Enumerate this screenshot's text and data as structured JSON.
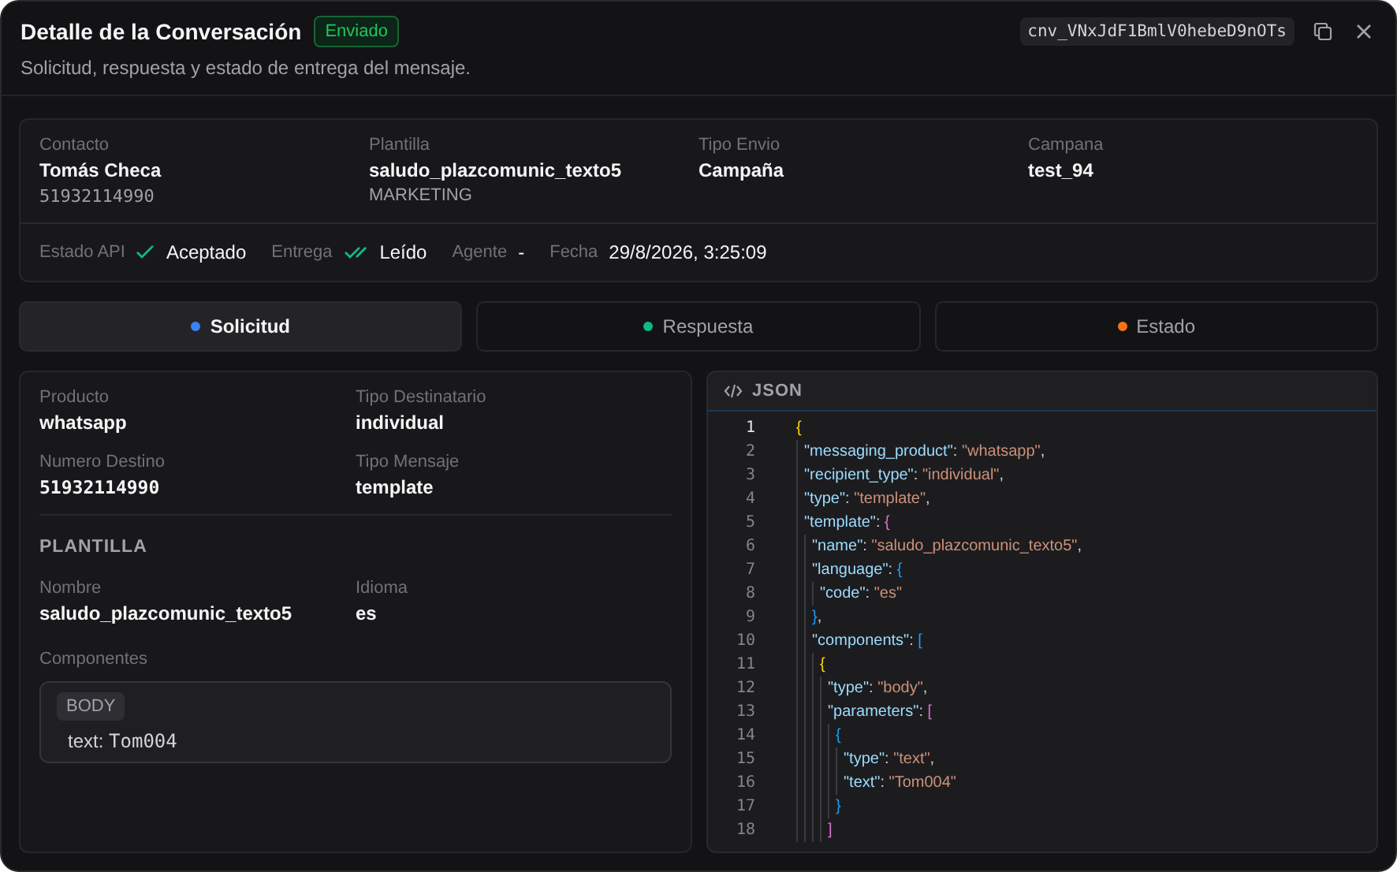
{
  "header": {
    "title": "Detalle de la Conversación",
    "badge": "Enviado",
    "subtitle": "Solicitud, respuesta y estado de entrega del mensaje.",
    "conversation_id": "cnv_VNxJdF1BmlV0hebeD9nOTs"
  },
  "summary": {
    "fields": [
      {
        "label": "Contacto",
        "value": "Tomás Checa",
        "sub": {
          "text": "51932114990",
          "kind": "mono"
        }
      },
      {
        "label": "Plantilla",
        "value": "saludo_plazcomunic_texto5",
        "sub": {
          "text": "MARKETING",
          "kind": "plain"
        }
      },
      {
        "label": "Tipo Envio",
        "value": "Campaña"
      },
      {
        "label": "Campana",
        "value": "test_94"
      }
    ],
    "status": [
      {
        "label": "Estado API",
        "kind": "check",
        "value": "Aceptado"
      },
      {
        "label": "Entrega",
        "kind": "double",
        "value": "Leído"
      },
      {
        "label": "Agente",
        "kind": "plain",
        "value": "-"
      },
      {
        "label": "Fecha",
        "kind": "plain",
        "value": "29/8/2026, 3:25:09"
      }
    ]
  },
  "tabs": [
    {
      "label": "Solicitud",
      "selected": true,
      "color": "#3b82f6"
    },
    {
      "label": "Respuesta",
      "selected": false,
      "color": "#10b981"
    },
    {
      "label": "Estado",
      "selected": false,
      "color": "#f97316"
    }
  ],
  "request": {
    "fields": [
      {
        "label": "Producto",
        "value": "whatsapp",
        "kind": "plain"
      },
      {
        "label": "Tipo Destinatario",
        "value": "individual",
        "kind": "plain"
      },
      {
        "label": "Numero Destino",
        "value": "51932114990",
        "kind": "mono"
      },
      {
        "label": "Tipo Mensaje",
        "value": "template",
        "kind": "plain"
      }
    ],
    "section_title": "PLANTILLA",
    "template_fields": [
      {
        "label": "Nombre",
        "value": "saludo_plazcomunic_texto5",
        "kind": "plain"
      },
      {
        "label": "Idioma",
        "value": "es",
        "kind": "plain"
      }
    ],
    "components_label": "Componentes",
    "components": [
      {
        "type": "BODY",
        "params": [
          {
            "key": "text:",
            "value": "Tom004"
          }
        ]
      }
    ]
  },
  "json_panel": {
    "title": "JSON",
    "lines": [
      {
        "number": "1",
        "tokens": [
          {
            "kind": "brace",
            "text": "{"
          }
        ]
      },
      {
        "number": "2",
        "tokens": [
          {
            "kind": "key",
            "text": " \"messaging_product\""
          },
          {
            "kind": "punct",
            "text": ": "
          },
          {
            "kind": "string",
            "text": "\"whatsapp\""
          },
          {
            "kind": "punct",
            "text": ","
          }
        ]
      },
      {
        "number": "3",
        "tokens": [
          {
            "kind": "key",
            "text": " \"recipient_type\""
          },
          {
            "kind": "punct",
            "text": ": "
          },
          {
            "kind": "string",
            "text": "\"individual\""
          },
          {
            "kind": "punct",
            "text": ","
          }
        ]
      },
      {
        "number": "4",
        "tokens": [
          {
            "kind": "key",
            "text": " \"type\""
          },
          {
            "kind": "punct",
            "text": ": "
          },
          {
            "kind": "string",
            "text": "\"template\""
          },
          {
            "kind": "punct",
            "text": ","
          }
        ]
      },
      {
        "number": "5",
        "tokens": [
          {
            "kind": "key",
            "text": " \"template\""
          },
          {
            "kind": "punct",
            "text": ": "
          },
          {
            "kind": "bracket",
            "text": "{"
          }
        ]
      },
      {
        "number": "6",
        "tokens": [
          {
            "kind": "key",
            "text": "  \"name\""
          },
          {
            "kind": "punct",
            "text": ": "
          },
          {
            "kind": "string",
            "text": "\"saludo_plazcomunic_texto5\""
          },
          {
            "kind": "punct",
            "text": ","
          }
        ]
      },
      {
        "number": "7",
        "tokens": [
          {
            "kind": "key",
            "text": "  \"language\""
          },
          {
            "kind": "punct",
            "text": ": "
          },
          {
            "kind": "paren",
            "text": "{"
          }
        ]
      },
      {
        "number": "8",
        "tokens": [
          {
            "kind": "key",
            "text": "   \"code\""
          },
          {
            "kind": "punct",
            "text": ": "
          },
          {
            "kind": "string",
            "text": "\"es\""
          }
        ]
      },
      {
        "number": "9",
        "tokens": [
          {
            "kind": "paren",
            "text": "  }"
          },
          {
            "kind": "punct",
            "text": ","
          }
        ]
      },
      {
        "number": "10",
        "tokens": [
          {
            "kind": "key",
            "text": "  \"components\""
          },
          {
            "kind": "punct",
            "text": ": "
          },
          {
            "kind": "paren",
            "text": "["
          }
        ]
      },
      {
        "number": "11",
        "tokens": [
          {
            "kind": "brace",
            "text": "   {"
          }
        ]
      },
      {
        "number": "12",
        "tokens": [
          {
            "kind": "key",
            "text": "    \"type\""
          },
          {
            "kind": "punct",
            "text": ": "
          },
          {
            "kind": "string",
            "text": "\"body\""
          },
          {
            "kind": "punct",
            "text": ","
          }
        ]
      },
      {
        "number": "13",
        "tokens": [
          {
            "kind": "key",
            "text": "    \"parameters\""
          },
          {
            "kind": "punct",
            "text": ": "
          },
          {
            "kind": "bracket",
            "text": "["
          }
        ]
      },
      {
        "number": "14",
        "tokens": [
          {
            "kind": "paren",
            "text": "     {"
          }
        ]
      },
      {
        "number": "15",
        "tokens": [
          {
            "kind": "key",
            "text": "      \"type\""
          },
          {
            "kind": "punct",
            "text": ": "
          },
          {
            "kind": "string",
            "text": "\"text\""
          },
          {
            "kind": "punct",
            "text": ","
          }
        ]
      },
      {
        "number": "16",
        "tokens": [
          {
            "kind": "key",
            "text": "      \"text\""
          },
          {
            "kind": "punct",
            "text": ": "
          },
          {
            "kind": "string",
            "text": "\"Tom004\""
          }
        ]
      },
      {
        "number": "17",
        "tokens": [
          {
            "kind": "paren",
            "text": "     }"
          }
        ]
      },
      {
        "number": "18",
        "tokens": [
          {
            "kind": "bracket",
            "text": "    ]"
          }
        ]
      }
    ]
  }
}
